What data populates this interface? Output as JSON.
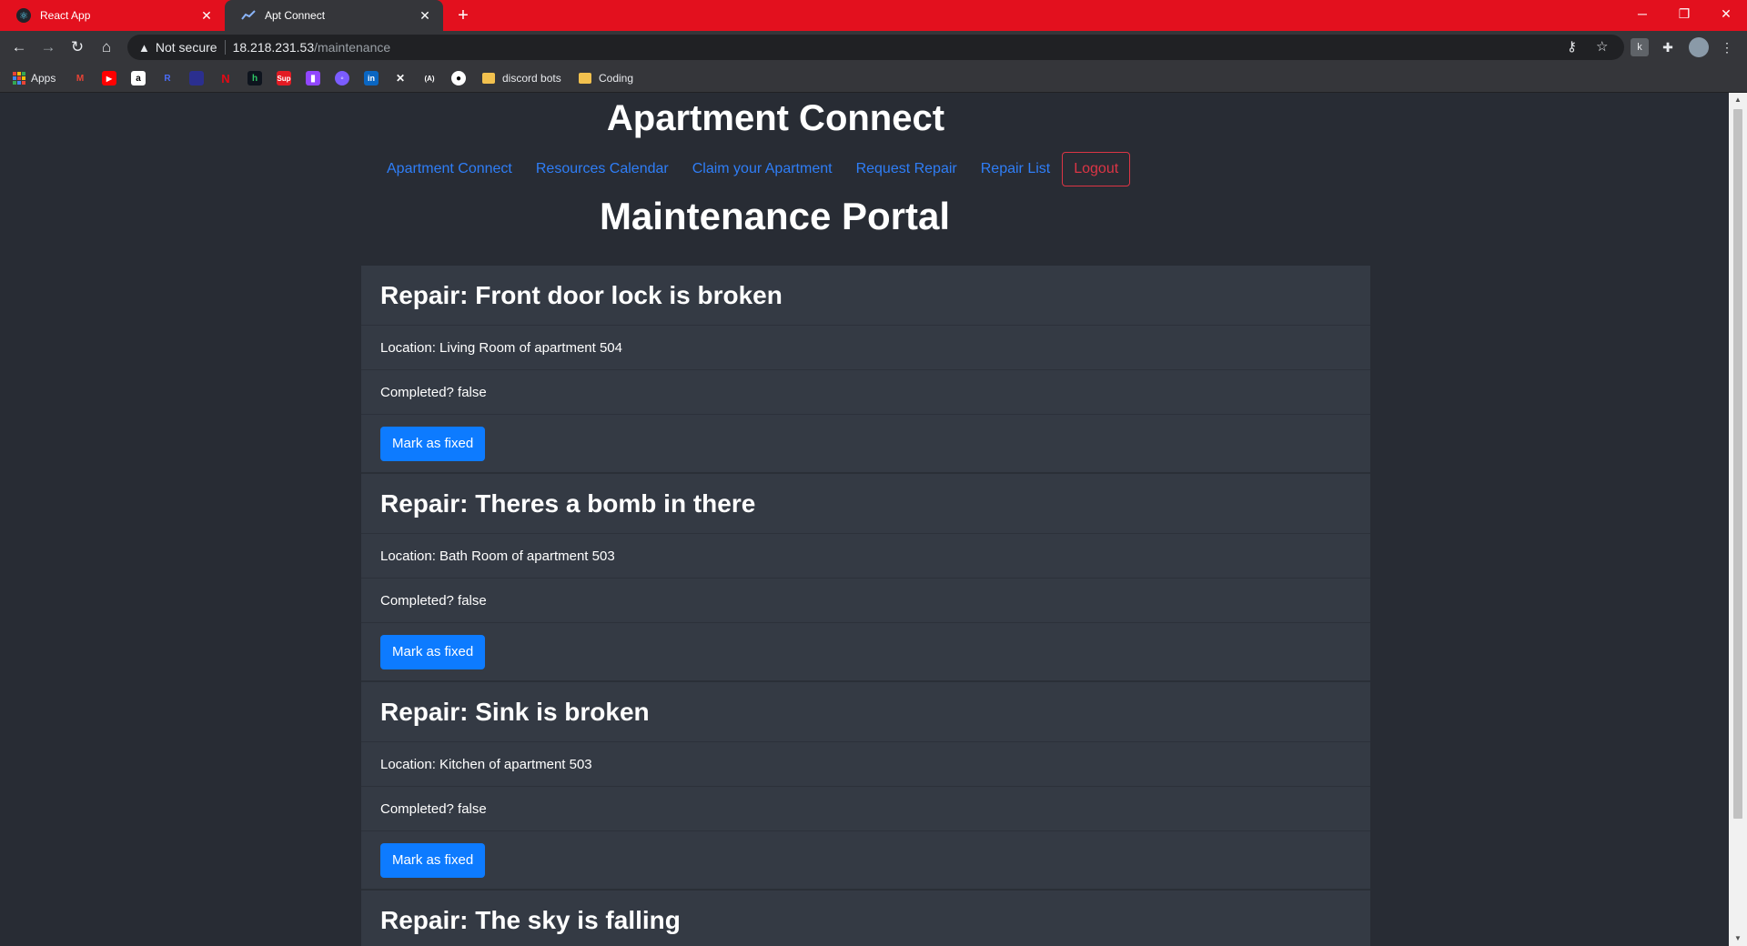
{
  "browser": {
    "tabs": [
      {
        "title": "React App"
      },
      {
        "title": "Apt Connect"
      }
    ],
    "close_glyph": "✕",
    "new_tab_glyph": "+",
    "security_label": "Not secure",
    "url_host": "18.218.231.53",
    "url_path": "/maintenance",
    "bookmarks": {
      "apps_label": "Apps",
      "folder_1": "discord bots",
      "folder_2": "Coding"
    }
  },
  "header": {
    "app_title": "Apartment Connect",
    "nav": [
      "Apartment Connect",
      "Resources Calendar",
      "Claim your Apartment",
      "Request Repair",
      "Repair List"
    ],
    "logout_label": "Logout"
  },
  "main": {
    "page_title": "Maintenance Portal",
    "repairs": [
      {
        "title": "Repair: Front door lock is broken",
        "location": "Location: Living Room of apartment 504",
        "completed": "Completed? false",
        "button": "Mark as fixed"
      },
      {
        "title": "Repair: Theres a bomb in there",
        "location": "Location: Bath Room of apartment 503",
        "completed": "Completed? false",
        "button": "Mark as fixed"
      },
      {
        "title": "Repair: Sink is broken",
        "location": "Location: Kitchen of apartment 503",
        "completed": "Completed? false",
        "button": "Mark as fixed"
      },
      {
        "title": "Repair: The sky is falling"
      }
    ]
  },
  "colors": {
    "titlebar": "#e3101e",
    "page_bg": "#282c34",
    "card_bg": "#343a44",
    "link": "#2f7ef7",
    "logout": "#dc3545",
    "button": "#0d7bff"
  }
}
